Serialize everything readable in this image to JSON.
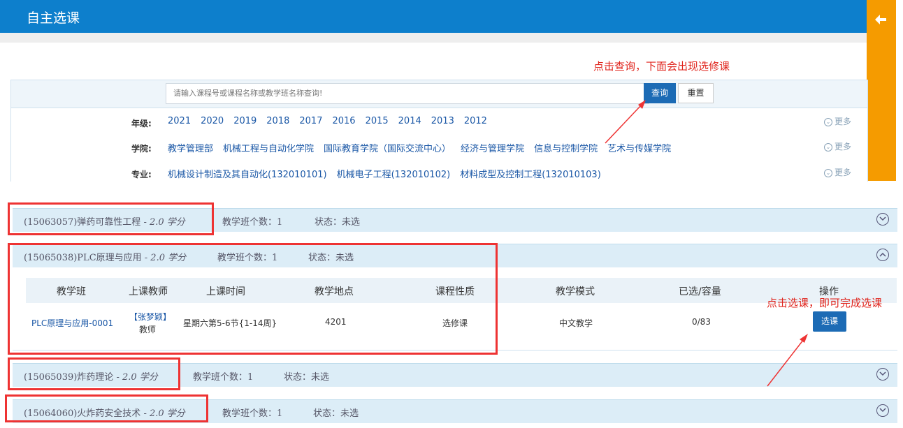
{
  "header": {
    "title": "自主选课"
  },
  "annotations": {
    "query_hint": "点击查询，下面会出现选修课",
    "select_hint": "点击选课，即可完成选课"
  },
  "search": {
    "placeholder": "请输入课程号或课程名称或教学班名称查询!",
    "query_label": "查询",
    "reset_label": "重置"
  },
  "filters": {
    "more_label": "更多",
    "grade": {
      "label": "年级:",
      "options": [
        "2021",
        "2020",
        "2019",
        "2018",
        "2017",
        "2016",
        "2015",
        "2014",
        "2013",
        "2012"
      ]
    },
    "college": {
      "label": "学院:",
      "options": [
        "教学管理部",
        "机械工程与自动化学院",
        "国际教育学院（国际交流中心）",
        "经济与管理学院",
        "信息与控制学院",
        "艺术与传媒学院"
      ]
    },
    "major": {
      "label": "专业:",
      "options": [
        "机械设计制造及其自动化(132010101)",
        "机械电子工程(132010102)",
        "材料成型及控制工程(132010103)"
      ]
    }
  },
  "courses": [
    {
      "code_name": "(15063057)弹药可靠性工程 - ",
      "credit": "2.0 学分",
      "count": "教学班个数：1",
      "status": "状态：未选"
    },
    {
      "code_name": "(15065038)PLC原理与应用 - ",
      "credit": "2.0 学分",
      "count": "教学班个数：1",
      "status": "状态：未选"
    },
    {
      "code_name": "(15065039)炸药理论 - ",
      "credit": "2.0 学分",
      "count": "教学班个数：1",
      "status": "状态：未选"
    },
    {
      "code_name": "(15064060)火炸药安全技术 - ",
      "credit": "2.0 学分",
      "count": "教学班个数：1",
      "status": "状态：未选"
    }
  ],
  "table": {
    "headers": [
      "教学班",
      "上课教师",
      "上课时间",
      "教学地点",
      "课程性质",
      "教学模式",
      "已选/容量",
      "操作"
    ],
    "row": {
      "class_name": "PLC原理与应用-0001",
      "teacher_name": "【张梦颖】",
      "teacher_title": "教师",
      "time": "星期六第5-6节{1-14周}",
      "location": "4201",
      "nature": "选修课",
      "mode": "中文教学",
      "capacity": "0/83",
      "action_label": "选课"
    }
  }
}
